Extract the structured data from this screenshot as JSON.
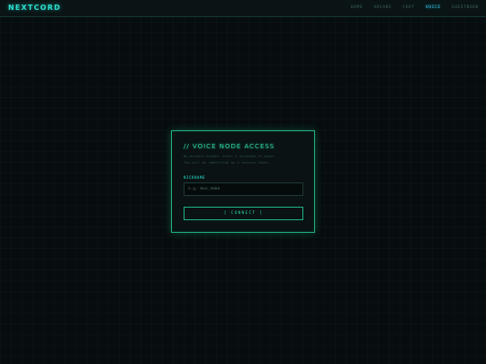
{
  "app": {
    "logo": "NEXTCORD"
  },
  "nav": {
    "items": [
      {
        "label": "HOME",
        "active": false
      },
      {
        "label": "ARCADE",
        "active": false
      },
      {
        "label": "CHAT",
        "active": false
      },
      {
        "label": "VOICE",
        "active": true
      },
      {
        "label": "GUESTBOOK",
        "active": false
      }
    ]
  },
  "panel": {
    "title": "// VOICE NODE ACCESS",
    "description_lines": [
      "No account needed. Enter a nickname to begin.",
      "You will be identified by a session token."
    ],
    "nickname_label": "NICKNAME",
    "nickname_placeholder": "e.g. Neo_9000",
    "nickname_value": "",
    "connect_label": "[ CONNECT ]"
  },
  "colors": {
    "accent_green": "#1fb585",
    "accent_cyan": "#2be0cf",
    "active_nav": "#39d7ff",
    "background": "#070d0e"
  }
}
